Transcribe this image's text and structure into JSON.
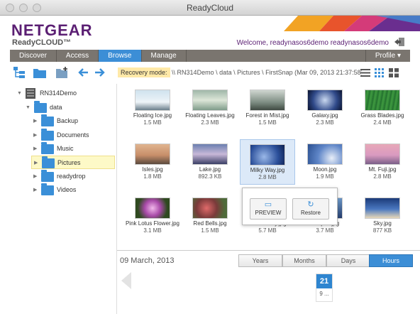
{
  "window": {
    "title": "ReadyCloud"
  },
  "header": {
    "logo": "NETGEAR",
    "sublogo": "ReadyCLOUD™",
    "welcome": "Welcome, readynasos6demo readynasos6demo"
  },
  "nav": {
    "tabs": [
      {
        "label": "Discover"
      },
      {
        "label": "Access"
      },
      {
        "label": "Browse"
      },
      {
        "label": "Manage"
      }
    ],
    "active": "Browse",
    "profile": "Profile ▾"
  },
  "toolbar": {
    "recovery_label": "Recovery mode:",
    "recovery_path": "\\\\ RN314Demo \\ data \\ Pictures \\ FirstSnap (Mar 09, 2013 21:37:58)"
  },
  "tree": {
    "device": "RN314Demo",
    "share": "data",
    "folders": [
      "Backup",
      "Documents",
      "Music",
      "Pictures",
      "readydrop",
      "Videos"
    ],
    "selected": "Pictures"
  },
  "files": [
    {
      "name": "Floating Ice.jpg",
      "size": "1.5 MB"
    },
    {
      "name": "Floating Leaves.jpg",
      "size": "2.3 MB"
    },
    {
      "name": "Forest in Mist.jpg",
      "size": "1.5 MB"
    },
    {
      "name": "Galaxy.jpg",
      "size": "2.3 MB"
    },
    {
      "name": "Grass Blades.jpg",
      "size": "2.4 MB"
    },
    {
      "name": "Isles.jpg",
      "size": "1.8 MB"
    },
    {
      "name": "Lake.jpg",
      "size": "892.3 KB"
    },
    {
      "name": "Milky Way.jpg",
      "size": "2.8 MB"
    },
    {
      "name": "Moon.jpg",
      "size": "1.9 MB"
    },
    {
      "name": "Mt. Fuji.jpg",
      "size": "2.8 MB"
    },
    {
      "name": "Pink Lotus Flower.jpg",
      "size": "3.1 MB"
    },
    {
      "name": "Red Bells.jpg",
      "size": "1.5 MB"
    },
    {
      "name": "Rice Paddy.jpg",
      "size": "5.7 MB"
    },
    {
      "name": "Shapes.jpg",
      "size": "3.7 MB"
    },
    {
      "name": "Sky.jpg",
      "size": "877 KB"
    }
  ],
  "popup": {
    "preview": "PREVIEW",
    "restore": "Restore"
  },
  "timeline": {
    "date": "09 March, 2013",
    "segments": [
      "Years",
      "Months",
      "Days",
      "Hours"
    ],
    "active": "Hours",
    "day": "21",
    "day_sub": "9 ..."
  },
  "colors": {
    "brand": "#5b1f73",
    "accent": "#3c8ed6",
    "nav": "#7a756f",
    "recovery_highlight": "#ffe9a8"
  }
}
